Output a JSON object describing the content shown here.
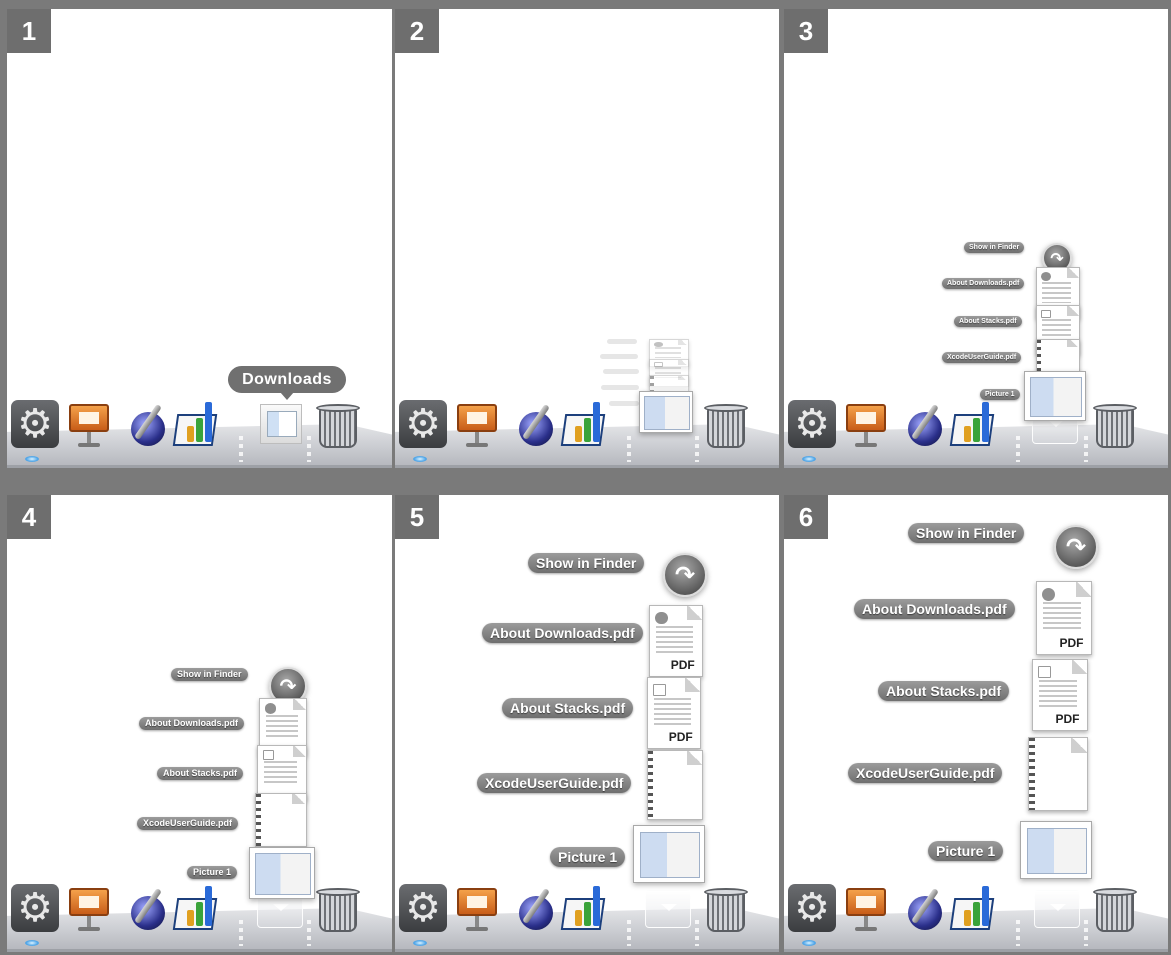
{
  "frames": [
    "1",
    "2",
    "3",
    "4",
    "5",
    "6"
  ],
  "dock": {
    "system_preferences": "gear-icon",
    "keynote": "keynote-icon",
    "script_editor": "script-editor-icon",
    "numbers": "numbers-icon",
    "downloads_stack": "downloads-stack-icon",
    "trash": "trash-icon",
    "tooltip": "Downloads",
    "collapse": "chevron-down-icon"
  },
  "stack": {
    "show_in_finder": "Show in Finder",
    "items": [
      "About Downloads.pdf",
      "About Stacks.pdf",
      "XcodeUserGuide.pdf",
      "Picture 1"
    ],
    "pdf_badge": "PDF"
  }
}
